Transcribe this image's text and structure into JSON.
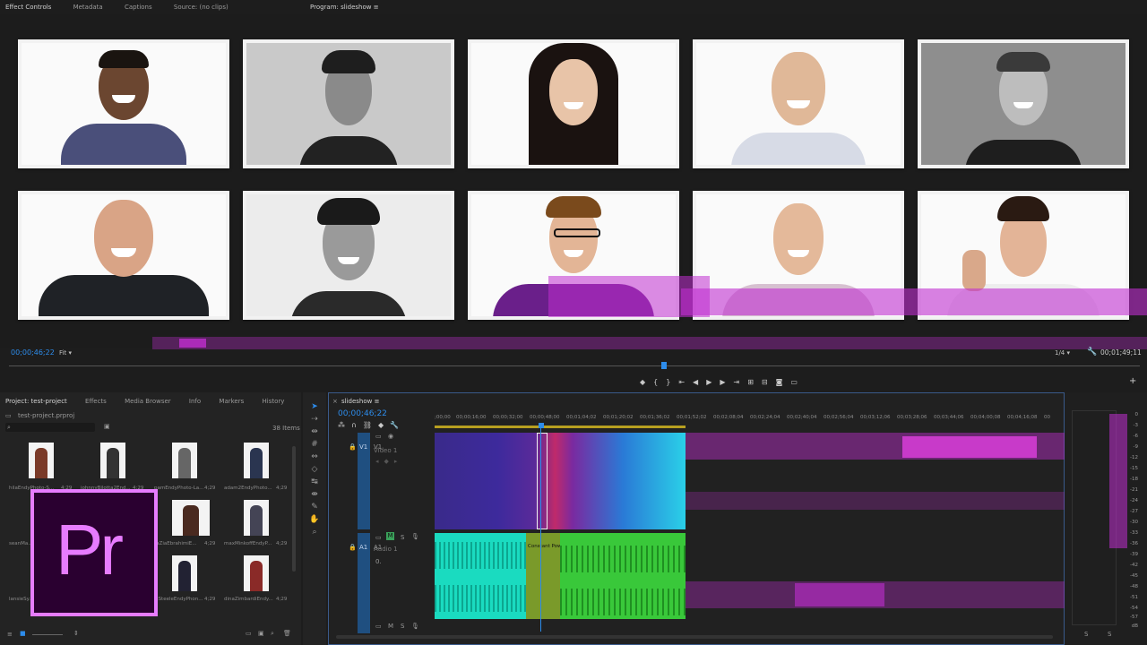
{
  "top_tabs": [
    "Effect Controls",
    "Metadata",
    "Captions",
    "Source: (no clips)"
  ],
  "program": {
    "title": "Program: slideshow",
    "timecode": "00;00;46;22",
    "fit": "Fit",
    "quality": "1/4",
    "duration": "00;01;49;11"
  },
  "project": {
    "tabs": [
      "Project: test-project",
      "Effects",
      "Media Browser",
      "Info",
      "Markers",
      "History"
    ],
    "file": "test-project.prproj",
    "item_count": "38 Items",
    "items": [
      {
        "name": "hilaEndyPhoto-S...",
        "dur": "4;29"
      },
      {
        "name": "johnnyBilotta2End...",
        "dur": "4;29"
      },
      {
        "name": "pamEndyPhoto-La...",
        "dur": "4;29"
      },
      {
        "name": "adam2EndyPhoto...",
        "dur": "4;29"
      },
      {
        "name": "seanMa...",
        "dur": ""
      },
      {
        "name": "raZiaEbrahimiE...",
        "dur": "4;29"
      },
      {
        "name": "maxMinkoffEndyP...",
        "dur": "4;29"
      },
      {
        "name": "lansieSy...",
        "dur": ""
      },
      {
        "name": "icSteeleEndyPhon...",
        "dur": "4;29"
      },
      {
        "name": "dinaZimbardiEndy...",
        "dur": "4;29"
      }
    ]
  },
  "timeline": {
    "title": "slideshow",
    "timecode": "00;00;46;22",
    "ruler": [
      ";00;00",
      "00;00;16;00",
      "00;00;32;00",
      "00;00;48;00",
      "00;01;04;02",
      "00;01;20;02",
      "00;01;36;02",
      "00;01;52;02",
      "00;02;08;04",
      "00;02;24;04",
      "00;02;40;04",
      "00;02;56;04",
      "00;03;12;06",
      "00;03;28;06",
      "00;03;44;06",
      "00;04;00;08",
      "00;04;16;08",
      "00"
    ],
    "video_track": {
      "src": "V1",
      "name": "V1",
      "label": "Video 1"
    },
    "audio_track": {
      "src": "A1",
      "name": "A1",
      "label": "Audio 1",
      "m": "M",
      "s": "S",
      "volume": "0."
    },
    "transition": "Constant Pow"
  },
  "meter_labels": [
    "0",
    "-3",
    "-6",
    "-9",
    "-12",
    "-15",
    "-18",
    "-21",
    "-24",
    "-27",
    "-30",
    "-33",
    "-36",
    "-39",
    "-42",
    "-45",
    "-48",
    "-51",
    "-54",
    "-57",
    "dB"
  ],
  "meter_footer": [
    "S",
    "S"
  ],
  "logo": {
    "text": "Pr",
    "bg": "#2a0030",
    "accent": "#e77cff"
  },
  "colors": {
    "accent": "#2d8ceb",
    "glitch": "#c02ed0"
  }
}
